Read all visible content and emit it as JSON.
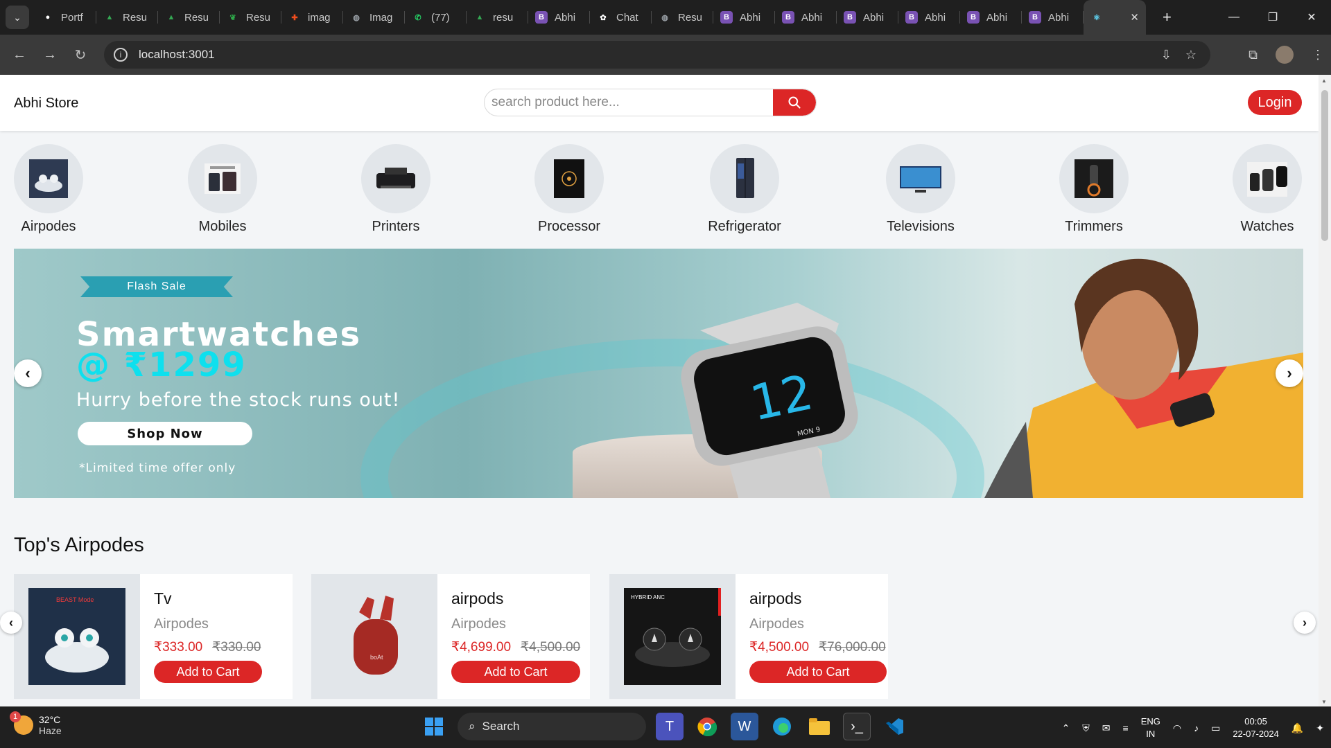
{
  "browser": {
    "tabs": [
      {
        "label": "Portf",
        "icon": "github-icon",
        "color": "#ffffff"
      },
      {
        "label": "Resu",
        "icon": "drive-icon",
        "color": "#34a853"
      },
      {
        "label": "Resu",
        "icon": "drive-icon",
        "color": "#34a853"
      },
      {
        "label": "Resu",
        "icon": "leaf-icon",
        "color": "#2eaa4a"
      },
      {
        "label": "imag",
        "icon": "figma-icon",
        "color": "#f24e1e"
      },
      {
        "label": "Imag",
        "icon": "globe-icon",
        "color": "#9aa0a6"
      },
      {
        "label": "(77)",
        "icon": "whatsapp-icon",
        "color": "#25d366"
      },
      {
        "label": "resu",
        "icon": "drive-icon",
        "color": "#34a853"
      },
      {
        "label": "Abhi",
        "icon": "bootstrap-icon",
        "color": "#7952b3"
      },
      {
        "label": "Chat",
        "icon": "openai-icon",
        "color": "#ffffff"
      },
      {
        "label": "Resu",
        "icon": "globe-icon",
        "color": "#9aa0a6"
      },
      {
        "label": "Abhi",
        "icon": "bootstrap-icon",
        "color": "#7952b3"
      },
      {
        "label": "Abhi",
        "icon": "bootstrap-icon",
        "color": "#7952b3"
      },
      {
        "label": "Abhi",
        "icon": "bootstrap-icon",
        "color": "#7952b3"
      },
      {
        "label": "Abhi",
        "icon": "bootstrap-icon",
        "color": "#7952b3"
      },
      {
        "label": "Abhi",
        "icon": "bootstrap-icon",
        "color": "#7952b3"
      },
      {
        "label": "Abhi",
        "icon": "bootstrap-icon",
        "color": "#7952b3"
      }
    ],
    "url": "localhost:3001"
  },
  "header": {
    "brand": "Abhi Store",
    "search_placeholder": "search product here...",
    "login_label": "Login"
  },
  "categories": [
    {
      "label": "Airpodes"
    },
    {
      "label": "Mobiles"
    },
    {
      "label": "Printers"
    },
    {
      "label": "Processor"
    },
    {
      "label": "Refrigerator"
    },
    {
      "label": "Televisions"
    },
    {
      "label": "Trimmers"
    },
    {
      "label": "Watches"
    }
  ],
  "banner": {
    "tag": "Flash Sale",
    "title": "Smartwatches",
    "price": "@ ₹1299",
    "subtitle": "Hurry before the stock runs out!",
    "cta": "Shop Now",
    "note": "*Limited time offer only",
    "watch_face": "12",
    "watch_date": "MON 9"
  },
  "section": {
    "title": "Top's Airpodes"
  },
  "products": [
    {
      "name": "Tv",
      "category": "Airpodes",
      "price": "₹333.00",
      "mrp": "₹330.00",
      "button": "Add to Cart",
      "image_label": "BEAST Mode"
    },
    {
      "name": "airpods",
      "category": "Airpodes",
      "price": "₹4,699.00",
      "mrp": "₹4,500.00",
      "button": "Add to Cart",
      "image_label": "boAt"
    },
    {
      "name": "airpods",
      "category": "Airpodes",
      "price": "₹4,500.00",
      "mrp": "₹76,000.00",
      "button": "Add to Cart",
      "image_label": "HYBRID ANC"
    }
  ],
  "colors": {
    "accent": "#dc2626",
    "banner_teal": "#7fb1b3"
  },
  "taskbar": {
    "temperature": "32°C",
    "weather": "Haze",
    "weather_badge": "1",
    "search_label": "Search",
    "language_top": "ENG",
    "language_bottom": "IN",
    "time": "00:05",
    "date": "22-07-2024"
  }
}
